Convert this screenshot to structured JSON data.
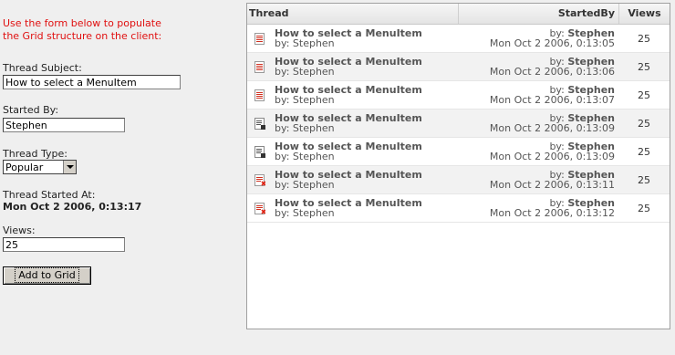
{
  "form": {
    "intro_line1": "Use the form below to populate",
    "intro_line2": "the Grid structure on the client:",
    "subject_label": "Thread Subject:",
    "subject_value": "How to select a MenuItem",
    "started_by_label": "Started By:",
    "started_by_value": "Stephen",
    "type_label": "Thread Type:",
    "type_value": "Popular",
    "started_at_label": "Thread Started At:",
    "started_at_value": "Mon Oct 2 2006, 0:13:17",
    "views_label": "Views:",
    "views_value": "25",
    "add_button": "Add to Grid"
  },
  "grid": {
    "columns": {
      "thread": "Thread",
      "started_by": "StartedBy",
      "views": "Views"
    },
    "rows": [
      {
        "icon": "doc-icon",
        "subject": "How to select a MenuItem",
        "by": "by: Stephen",
        "by_prefix": "by: ",
        "by_name": "Stephen",
        "date": "Mon Oct 2 2006, 0:13:05",
        "views": "25"
      },
      {
        "icon": "doc-icon",
        "subject": "How to select a MenuItem",
        "by": "by: Stephen",
        "by_prefix": "by: ",
        "by_name": "Stephen",
        "date": "Mon Oct 2 2006, 0:13:06",
        "views": "25"
      },
      {
        "icon": "doc-icon",
        "subject": "How to select a MenuItem",
        "by": "by: Stephen",
        "by_prefix": "by: ",
        "by_name": "Stephen",
        "date": "Mon Oct 2 2006, 0:13:07",
        "views": "25"
      },
      {
        "icon": "locked-doc-icon",
        "subject": "How to select a MenuItem",
        "by": "by: Stephen",
        "by_prefix": "by: ",
        "by_name": "Stephen",
        "date": "Mon Oct 2 2006, 0:13:09",
        "views": "25"
      },
      {
        "icon": "locked-doc-icon",
        "subject": "How to select a MenuItem",
        "by": "by: Stephen",
        "by_prefix": "by: ",
        "by_name": "Stephen",
        "date": "Mon Oct 2 2006, 0:13:09",
        "views": "25"
      },
      {
        "icon": "hot-doc-icon",
        "subject": "How to select a MenuItem",
        "by": "by: Stephen",
        "by_prefix": "by: ",
        "by_name": "Stephen",
        "date": "Mon Oct 2 2006, 0:13:11",
        "views": "25"
      },
      {
        "icon": "hot-doc-icon",
        "subject": "How to select a MenuItem",
        "by": "by: Stephen",
        "by_prefix": "by: ",
        "by_name": "Stephen",
        "date": "Mon Oct 2 2006, 0:13:12",
        "views": "25"
      }
    ]
  },
  "colors": {
    "intro_text": "#e01010",
    "doc_icon_accent": "#d03020",
    "locked_icon_accent": "#333333",
    "alt_row": "#f2f2f2"
  }
}
